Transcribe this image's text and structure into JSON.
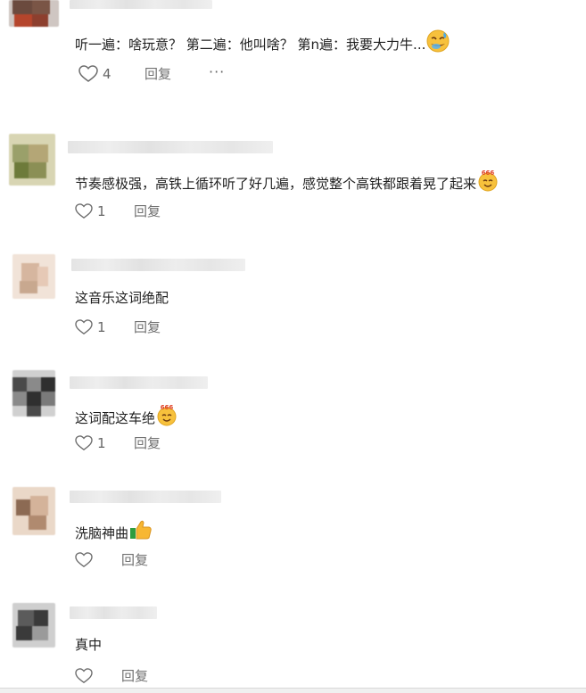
{
  "comments": [
    {
      "text": "听一遍：啥玩意？ 第二遍：他叫啥？ 第n遍：我要大力牛...",
      "emoji": "sweat-smile-emoji",
      "likes": "4",
      "reply_label": "回复",
      "more_label": "···"
    },
    {
      "text": "节奏感极强，高铁上循环听了好几遍，感觉整个高铁都跟着晃了起来",
      "emoji": "666-emoji",
      "likes": "1",
      "reply_label": "回复"
    },
    {
      "text": "这音乐这词绝配",
      "likes": "1",
      "reply_label": "回复"
    },
    {
      "text": "这词配这车绝",
      "emoji": "666-emoji",
      "likes": "1",
      "reply_label": "回复"
    },
    {
      "text": "洗脑神曲",
      "emoji": "thumbs-up-emoji",
      "likes": "",
      "reply_label": "回复"
    },
    {
      "text": "真中",
      "likes": "",
      "reply_label": "回复"
    }
  ],
  "colors": {
    "avatar_1": [
      "#6b4a3e",
      "#b5452c",
      "#8d3f2e",
      "#d2c9c4"
    ],
    "avatar_2": [
      "#9aa06a",
      "#b4a676",
      "#6d7a3a",
      "#d9d6b0"
    ],
    "avatar_3": [
      "#d6b69f",
      "#e6c9b6",
      "#c8a88f",
      "#f1e3d8"
    ],
    "avatar_4": [
      "#2f2f2f",
      "#4a4a4a",
      "#8a8a8a",
      "#d0d0d0"
    ],
    "avatar_5": [
      "#b08a6f",
      "#d4b39a",
      "#8c6a53",
      "#ead8c8"
    ],
    "avatar_6": [
      "#3a3a3a",
      "#5b5b5b",
      "#9a9a9a",
      "#cfcfcf"
    ]
  }
}
